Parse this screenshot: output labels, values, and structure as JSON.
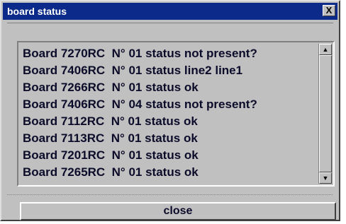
{
  "window": {
    "title": "board status",
    "close_glyph": "X",
    "colors": {
      "titlebar": "#0b2a8a",
      "face": "#c0c0c0",
      "text": "#0b0b2a"
    }
  },
  "list": {
    "rows": [
      "Board 7270RC  N° 01 status not present?",
      "Board 7406RC  N° 01 status line2 line1",
      "Board 7266RC  N° 01 status ok",
      "Board 7406RC  N° 04 status not present?",
      "Board 7112RC  N° 01 status ok",
      "Board 7113RC  N° 01 status ok",
      "Board 7201RC  N° 01 status ok",
      "Board 7265RC  N° 01 status ok"
    ],
    "scroll_up_icon": "up-arrow-icon",
    "scroll_down_icon": "down-arrow-icon"
  },
  "footer": {
    "close_label": "close"
  }
}
